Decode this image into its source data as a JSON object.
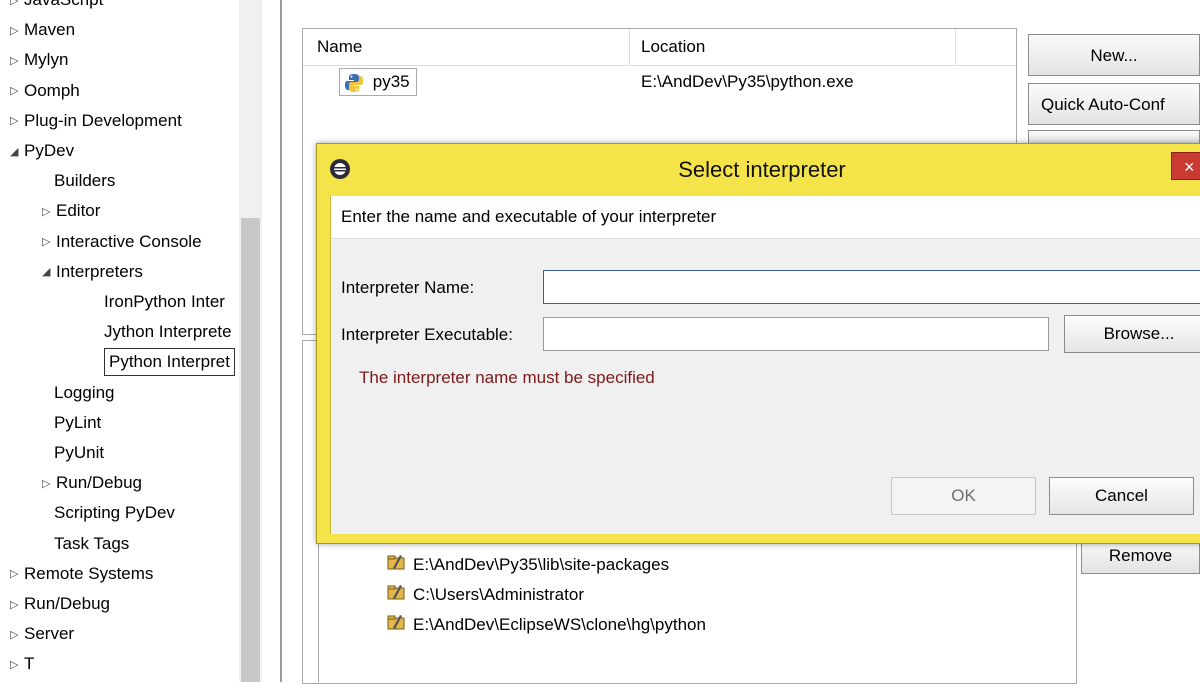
{
  "tree": {
    "items": [
      {
        "label": "JavaScript",
        "arrow": "▷",
        "level": 0
      },
      {
        "label": "Maven",
        "arrow": "▷",
        "level": 0
      },
      {
        "label": "Mylyn",
        "arrow": "▷",
        "level": 0
      },
      {
        "label": "Oomph",
        "arrow": "▷",
        "level": 0
      },
      {
        "label": "Plug-in Development",
        "arrow": "▷",
        "level": 0
      },
      {
        "label": "PyDev",
        "arrow": "◢",
        "level": 0
      },
      {
        "label": "Builders",
        "arrow": "",
        "level": 1
      },
      {
        "label": "Editor",
        "arrow": "▷",
        "level": 1
      },
      {
        "label": "Interactive Console",
        "arrow": "▷",
        "level": 1
      },
      {
        "label": "Interpreters",
        "arrow": "◢",
        "level": 1
      },
      {
        "label": "IronPython Inter",
        "arrow": "",
        "level": 2
      },
      {
        "label": "Jython Interprete",
        "arrow": "",
        "level": 2
      },
      {
        "label": "Python Interpret",
        "arrow": "",
        "level": 2
      },
      {
        "label": "Logging",
        "arrow": "",
        "level": 1
      },
      {
        "label": "PyLint",
        "arrow": "",
        "level": 1
      },
      {
        "label": "PyUnit",
        "arrow": "",
        "level": 1
      },
      {
        "label": "Run/Debug",
        "arrow": "▷",
        "level": 1
      },
      {
        "label": "Scripting PyDev",
        "arrow": "",
        "level": 1
      },
      {
        "label": "Task Tags",
        "arrow": "",
        "level": 1
      },
      {
        "label": "Remote Systems",
        "arrow": "▷",
        "level": 0
      },
      {
        "label": "Run/Debug",
        "arrow": "▷",
        "level": 0
      },
      {
        "label": "Server",
        "arrow": "▷",
        "level": 0
      },
      {
        "label": "T",
        "arrow": "▷",
        "level": 0
      }
    ]
  },
  "interpreters": {
    "columns": [
      "Name",
      "Location"
    ],
    "rows": [
      {
        "name": "py35",
        "location": "E:\\AndDev\\Py35\\python.exe"
      }
    ]
  },
  "buttons": {
    "new": "New...",
    "quick_auto_config": "Quick Auto-Conf",
    "remove": "Remove"
  },
  "libraries": [
    "E:\\AndDev\\Py35\\lib\\site-packages",
    "C:\\Users\\Administrator",
    "E:\\AndDev\\EclipseWS\\clone\\hg\\python"
  ],
  "dialog": {
    "title": "Select interpreter",
    "close": "×",
    "description": "Enter the name and executable of your interpreter",
    "name_label": "Interpreter Name:",
    "name_value": "",
    "exec_label": "Interpreter Executable:",
    "exec_value": "",
    "browse": "Browse...",
    "error": "The interpreter name must be specified",
    "ok": "OK",
    "cancel": "Cancel"
  }
}
